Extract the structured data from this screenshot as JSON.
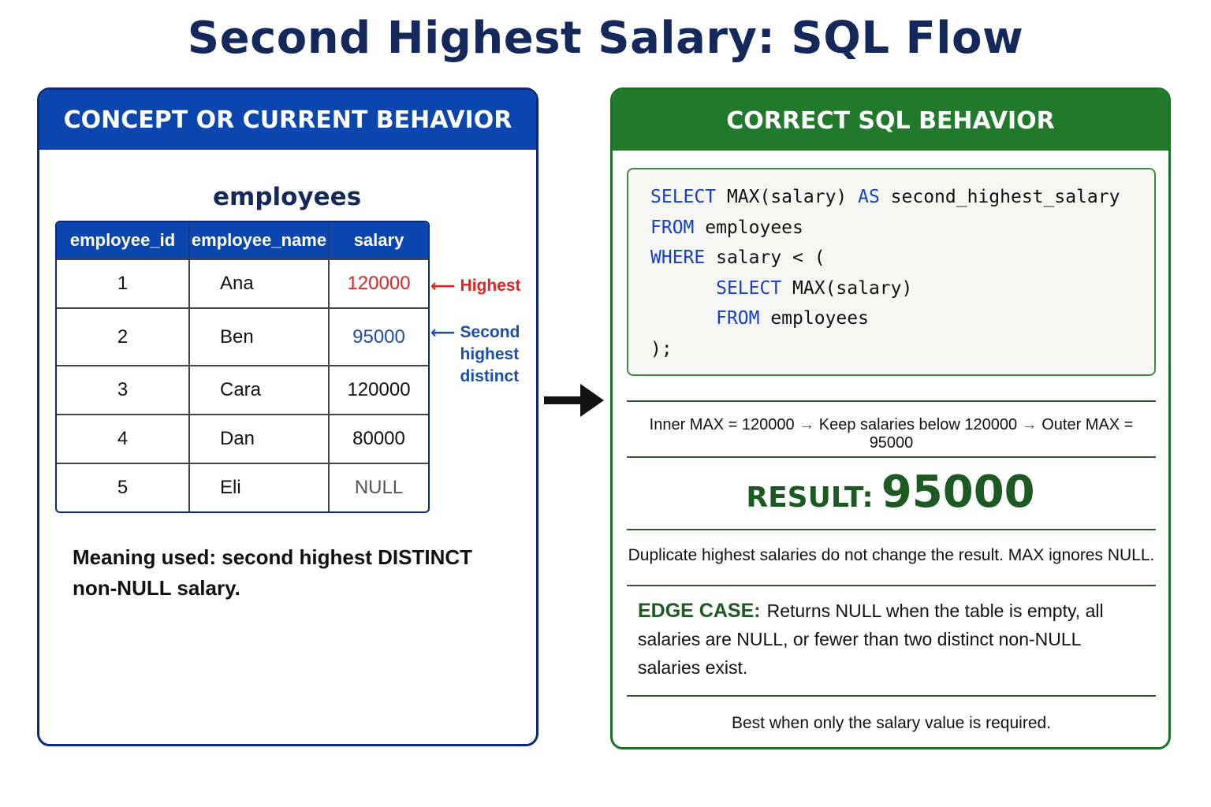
{
  "title": "Second Highest Salary: SQL Flow",
  "left_panel": {
    "header": "CONCEPT OR CURRENT BEHAVIOR",
    "table_title": "employees",
    "columns": [
      "employee_id",
      "employee_name",
      "salary"
    ],
    "rows": [
      {
        "employee_id": "1",
        "employee_name": "Ana",
        "salary": "120000",
        "color": "#e02424"
      },
      {
        "employee_id": "2",
        "employee_name": "Ben",
        "salary": "95000",
        "color": "#1a4eb0"
      },
      {
        "employee_id": "3",
        "employee_name": "Cara",
        "salary": "120000",
        "color": "#111111"
      },
      {
        "employee_id": "4",
        "employee_name": "Dan",
        "salary": "80000",
        "color": "#111111"
      },
      {
        "employee_id": "5",
        "employee_name": "Eli",
        "salary": "NULL",
        "color": "#555555"
      }
    ],
    "annotation_highest": "Highest",
    "annotation_second": [
      "Second",
      "highest",
      "distinct"
    ],
    "meaning_line1": "Meaning used: second highest DISTINCT",
    "meaning_line2": "non-NULL salary."
  },
  "right_panel": {
    "header": "CORRECT SQL BEHAVIOR",
    "code": {
      "l1_kw1": "SELECT",
      "l1_t1": " MAX(salary) ",
      "l1_kw2": "AS",
      "l1_t2": " second_highest_salary",
      "l2_kw": "FROM",
      "l2_t": " employees",
      "l3_kw": "WHERE",
      "l3_t": " salary < (",
      "l4_indent": "      ",
      "l4_kw": "SELECT",
      "l4_t": " MAX(salary)",
      "l5_indent": "      ",
      "l5_kw": "FROM",
      "l5_t": " employees",
      "l6_t": ");"
    },
    "flow": {
      "step1": "Inner MAX = 120000",
      "arrow": "→",
      "step2": "Keep salaries below 120000",
      "step3": "Outer MAX = 95000"
    },
    "result_label": "RESULT:",
    "result_value": "95000",
    "duplicate_note": "Duplicate highest salaries do not change the result. MAX ignores NULL.",
    "edge_label": "EDGE CASE:",
    "edge_text": "Returns NULL when the table is empty, all salaries are NULL, or fewer than two distinct non-NULL salaries exist.",
    "best_note": "Best when only the salary value is required."
  },
  "colors": {
    "left_accent": "#0a46ad",
    "right_accent": "#217a2c",
    "keyword": "#1540c8",
    "highest": "#e02424",
    "second": "#1a4eb0"
  },
  "icons": {
    "flow_arrow": "right-arrow-icon",
    "highest_pointer": "left-arrow-icon",
    "second_pointer": "left-arrow-icon"
  }
}
